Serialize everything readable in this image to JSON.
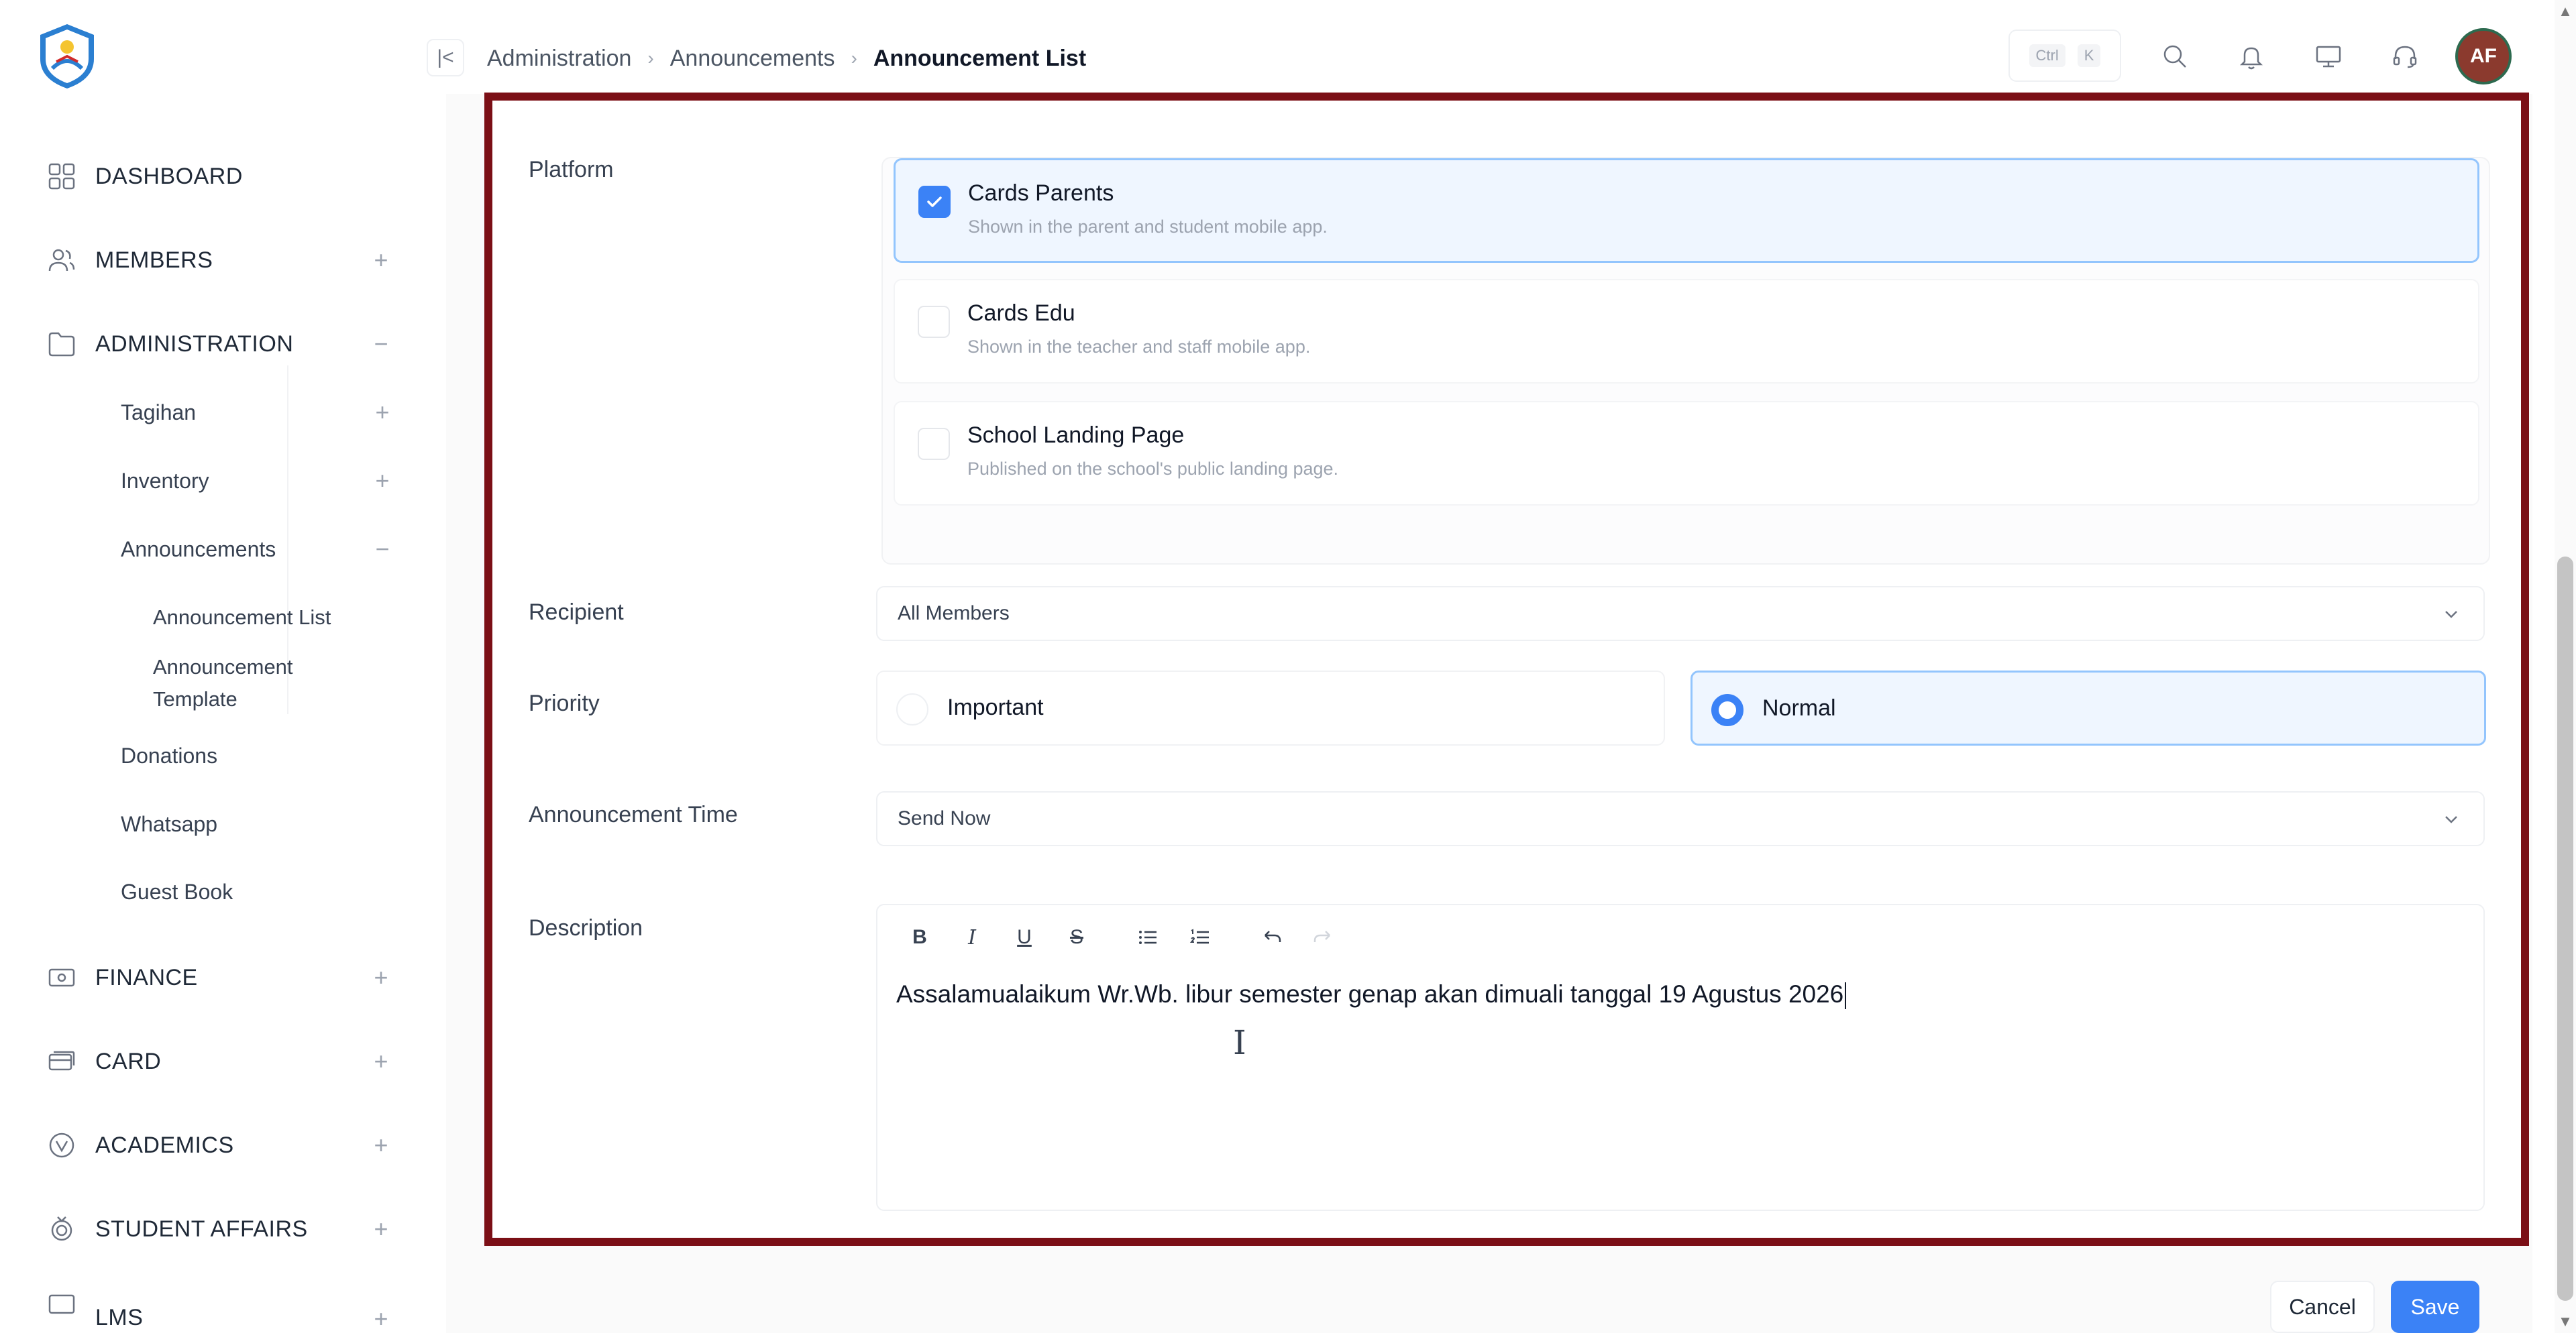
{
  "colors": {
    "accent": "#3b82f6",
    "highlight_border": "#7b0f16",
    "avatar_bg": "#8b3a2e"
  },
  "topbar": {
    "breadcrumb": [
      "Administration",
      "Announcements",
      "Announcement List"
    ],
    "shortcut": {
      "key1": "Ctrl",
      "key2": "K"
    },
    "avatar_initials": "AF"
  },
  "sidebar": {
    "dashboard": "DASHBOARD",
    "members": "MEMBERS",
    "administration": "ADMINISTRATION",
    "tagihan": "Tagihan",
    "inventory": "Inventory",
    "announcements": "Announcements",
    "announcement_list": "Announcement List",
    "announcement_template": "Announcement Template",
    "donations": "Donations",
    "whatsapp": "Whatsapp",
    "guest_book": "Guest Book",
    "finance": "FINANCE",
    "card": "CARD",
    "academics": "ACADEMICS",
    "student_affairs": "STUDENT AFFAIRS",
    "lms": "LMS"
  },
  "form": {
    "platform_label": "Platform",
    "platforms": [
      {
        "title": "Cards Parents",
        "desc": "Shown in the parent and student mobile app.",
        "checked": true
      },
      {
        "title": "Cards Edu",
        "desc": "Shown in the teacher and staff mobile app.",
        "checked": false
      },
      {
        "title": "School Landing Page",
        "desc": "Published on the school's public landing page.",
        "checked": false
      }
    ],
    "recipient_label": "Recipient",
    "recipient_value": "All Members",
    "priority_label": "Priority",
    "priority_options": [
      "Important",
      "Normal"
    ],
    "priority_selected": "Normal",
    "time_label": "Announcement Time",
    "time_value": "Send Now",
    "description_label": "Description",
    "toolbar": {
      "bold": "B",
      "italic": "I",
      "underline": "U",
      "strike": "S"
    },
    "description_text": "Assalamualaikum Wr.Wb. libur semester genap akan dimuali tanggal 19 Agustus 2026"
  },
  "footer": {
    "cancel": "Cancel",
    "save": "Save"
  }
}
